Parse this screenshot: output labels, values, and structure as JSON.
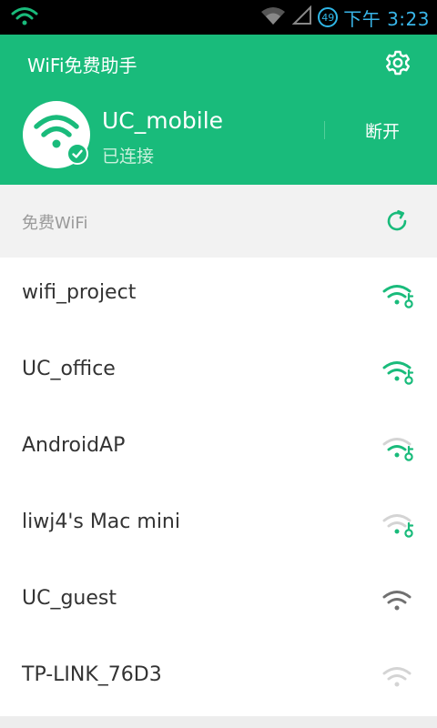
{
  "status_bar": {
    "left_icon": "wifi-signal-icon",
    "time": "下午 3:23",
    "battery_level": "49"
  },
  "header": {
    "title": "WiFi免费助手",
    "settings_icon": "gear-icon",
    "connected": {
      "ssid": "UC_mobile",
      "status": "已连接",
      "disconnect_label": "断开"
    }
  },
  "section": {
    "title": "免费WiFi",
    "refresh_icon": "refresh-icon"
  },
  "networks": [
    {
      "name": "wifi_project",
      "signal": "strong",
      "free_key": true
    },
    {
      "name": "UC_office",
      "signal": "strong",
      "free_key": true
    },
    {
      "name": "AndroidAP",
      "signal": "weak",
      "free_key": true
    },
    {
      "name": "liwj4's Mac mini",
      "signal": "weak",
      "free_key": true
    },
    {
      "name": "UC_guest",
      "signal": "gray-strong",
      "free_key": false
    },
    {
      "name": "TP-LINK_76D3",
      "signal": "gray-weak",
      "free_key": false
    }
  ],
  "colors": {
    "brand_green": "#19bb7b",
    "status_time_blue": "#39b5e8",
    "text_dark": "#333333",
    "text_gray": "#9a9a9a"
  }
}
